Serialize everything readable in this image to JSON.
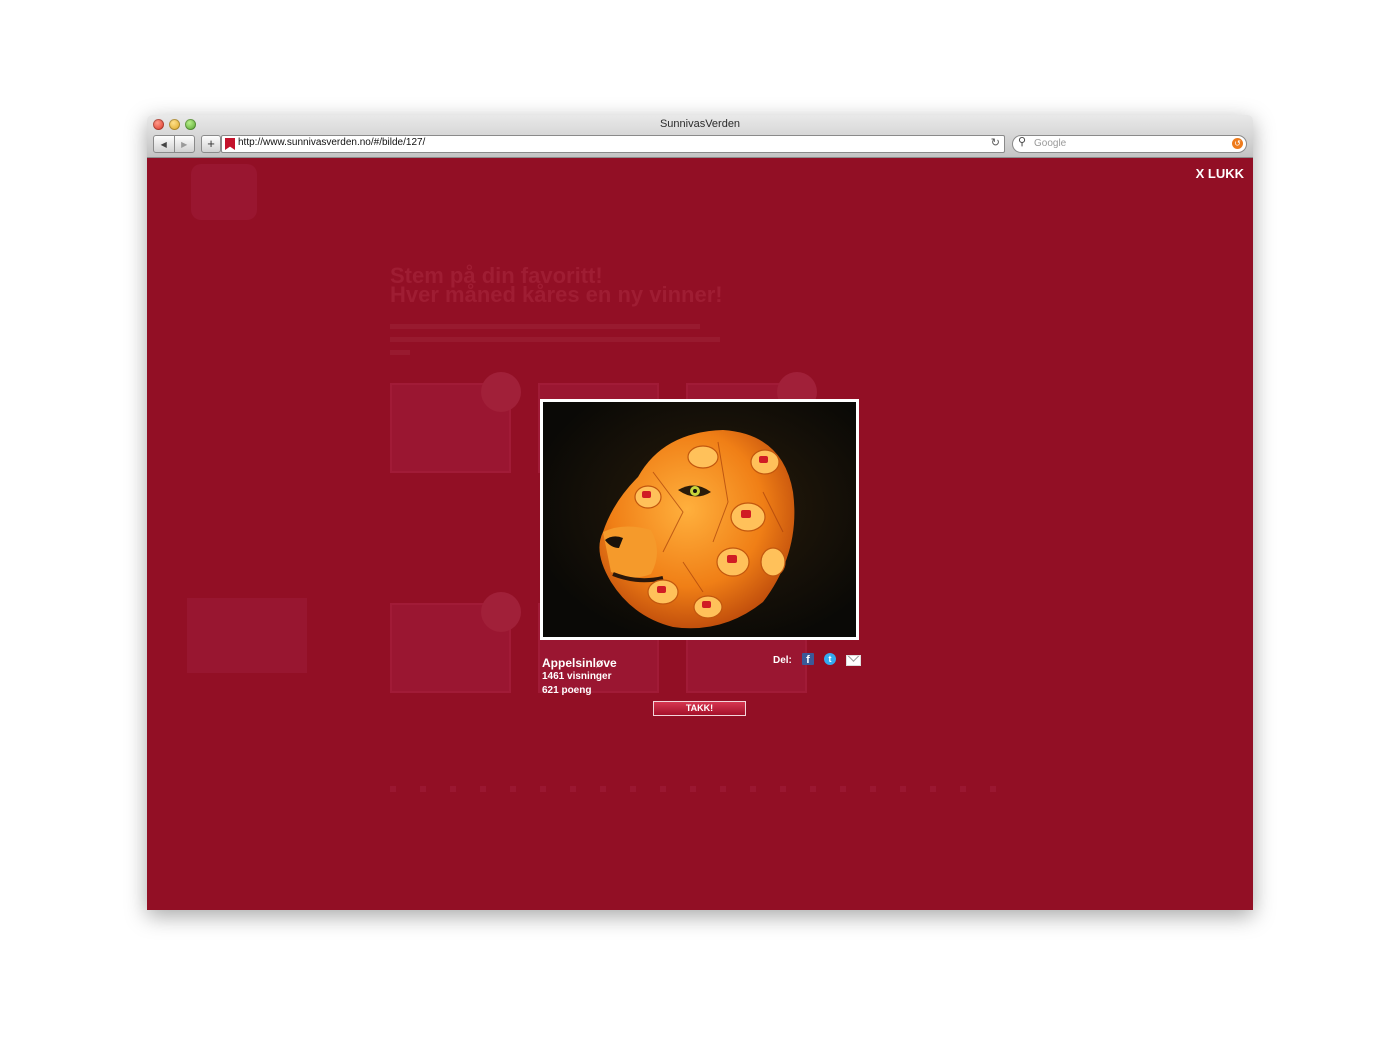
{
  "browser": {
    "window_title": "SunnivasVerden",
    "url": "http://www.sunnivasverden.no/#/bilde/127/",
    "search_placeholder": "Google",
    "back_icon": "◀",
    "forward_icon": "▶",
    "add_icon": "+",
    "reload_icon": "↻",
    "search_icon": "⚲",
    "snapback_icon": "↺"
  },
  "overlay": {
    "close_label": "X LUKK"
  },
  "photo": {
    "title": "Appelsinløve",
    "views": "1461 visninger",
    "points": "621 poeng",
    "share_label": "Del:",
    "facebook_icon": "f",
    "twitter_icon": "t",
    "vote_button": "TAKK!"
  },
  "background_page": {
    "heading_line1": "Stem på din favoritt!",
    "heading_line2": "Hver måned kåres en ny vinner!"
  },
  "colors": {
    "overlay": "#920f25",
    "button": "#c4233e",
    "text": "#ffffff"
  }
}
